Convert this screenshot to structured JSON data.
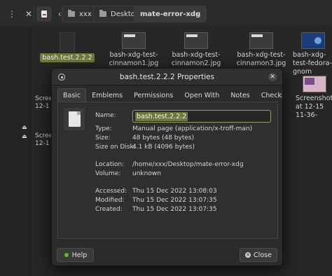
{
  "file_manager": {
    "breadcrumbs": [
      "xxx",
      "Desktop",
      "mate-error-xdg"
    ],
    "items": [
      {
        "label": "bash.test.2.2.2",
        "kind": "doc",
        "selected": true
      },
      {
        "label": "bash-xdg-test-cinnamon1.jpg",
        "kind": "dark"
      },
      {
        "label": "bash-xdg-test-cinnamon2.jpg",
        "kind": "dark"
      },
      {
        "label": "bash-xdg-test-cinnamon3.jpg",
        "kind": "dark"
      },
      {
        "label": "bash-xdg-test-fedora-gnom",
        "kind": "fedora"
      },
      {
        "label": "Screenshot at 12-15 11-36-",
        "kind": "pink"
      }
    ],
    "left_partial_labels": [
      "Scree",
      "12-1",
      "Scree",
      "12-1"
    ]
  },
  "dialog": {
    "title": "bash.test.2.2.2 Properties",
    "tabs": [
      "Basic",
      "Emblems",
      "Permissions",
      "Open With",
      "Notes",
      "Checksums"
    ],
    "active_tab": "Basic",
    "fields": {
      "name_label": "Name:",
      "name_value": "bash.test.2.2.2",
      "type_label": "Type:",
      "type_value": "Manual page (application/x-troff-man)",
      "size_label": "Size:",
      "size_value": "48 bytes (48 bytes)",
      "size_on_disk_label": "Size on Disk:",
      "size_on_disk_value": "4.1 kB (4096 bytes)",
      "location_label": "Location:",
      "location_value": "/home/xxx/Desktop/mate-error-xdg",
      "volume_label": "Volume:",
      "volume_value": "unknown",
      "accessed_label": "Accessed:",
      "accessed_value": "Thu 15 Dec 2022 13:08:03",
      "modified_label": "Modified:",
      "modified_value": "Thu 15 Dec 2022 13:07:35",
      "created_label": "Created:",
      "created_value": "Thu 15 Dec 2022 13:07:35"
    },
    "buttons": {
      "help": "Help",
      "close": "Close"
    }
  },
  "colors": {
    "selection": "#6b7a3a",
    "window_bg": "#2b2b2b",
    "desktop_bg": "#242424"
  }
}
